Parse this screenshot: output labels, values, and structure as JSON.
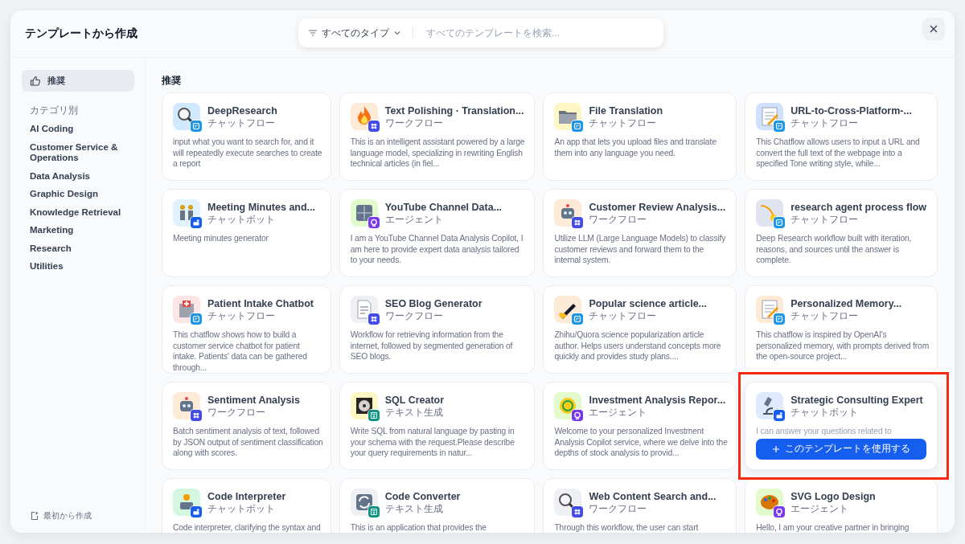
{
  "window": {
    "title": "テンプレートから作成"
  },
  "search": {
    "type_filter": "すべてのタイプ",
    "placeholder": "すべてのテンプレートを検索..."
  },
  "sidebar": {
    "recommended": {
      "label": "推奨",
      "selected": true
    },
    "category_heading": "カテゴリ別",
    "items": [
      {
        "label": "AI Coding",
        "selected": false
      },
      {
        "label": "Customer Service & Operations",
        "selected": false
      },
      {
        "label": "Data Analysis",
        "selected": false
      },
      {
        "label": "Graphic Design",
        "selected": false
      },
      {
        "label": "Knowledge Retrieval",
        "selected": false
      },
      {
        "label": "Marketing",
        "selected": false
      },
      {
        "label": "Research",
        "selected": false
      },
      {
        "label": "Utilities",
        "selected": false
      }
    ],
    "create_blank": "最初から作成"
  },
  "section_title": "推奨",
  "cards": [
    {
      "title": "DeepResearch",
      "type_label": "チャットフロー",
      "kind": "chatflow",
      "color": "#d1e9ff",
      "description": "input what you want to search for, and it will repeatedly execute searches to create a report",
      "hovered": false,
      "highlighted": false
    },
    {
      "title": "Text Polishing · Translation...",
      "type_label": "ワークフロー",
      "kind": "workflow",
      "color": "#fdead7",
      "description": "This is an intelligent assistant powered by a large language model, specializing in rewriting English technical articles (in fiel...",
      "hovered": false,
      "highlighted": false
    },
    {
      "title": "File Translation",
      "type_label": "チャットフロー",
      "kind": "chatflow",
      "color": "#fef7c3",
      "description": "An app that lets you upload files and translate them into any language you need.",
      "hovered": false,
      "highlighted": false
    },
    {
      "title": "URL-to-Cross-Platform-...",
      "type_label": "チャットフロー",
      "kind": "chatflow",
      "color": "#d1e0ff",
      "description": "This Chatflow allows users to input a URL and convert the full text of the webpage into a specified Tone writing style, while...",
      "hovered": false,
      "highlighted": false
    },
    {
      "title": "Meeting Minutes and...",
      "type_label": "チャットボット",
      "kind": "chatbot",
      "color": "#e0f2fe",
      "description": "Meeting minutes generator",
      "hovered": false,
      "highlighted": false
    },
    {
      "title": "YouTube Channel Data...",
      "type_label": "エージェント",
      "kind": "agent",
      "color": "#e3fbcc",
      "description": "I am a YouTube Channel Data Analysis Copilot, I am here to provide expert data analysis tailored to your needs.",
      "hovered": false,
      "highlighted": false
    },
    {
      "title": "Customer Review Analysis...",
      "type_label": "ワークフロー",
      "kind": "workflow",
      "color": "#fdead7",
      "description": "Utilize LLM (Large Language Models) to classify customer reviews and forward them to the internal system.",
      "hovered": false,
      "highlighted": false
    },
    {
      "title": "research agent process flow",
      "type_label": "チャットフロー",
      "kind": "chatflow",
      "color": "#e0e3f0",
      "description": "Deep Research workflow built with iteration, reasons, and sources until the answer is complete.",
      "hovered": false,
      "highlighted": false
    },
    {
      "title": "Patient Intake Chatbot",
      "type_label": "チャットフロー",
      "kind": "chatflow",
      "color": "#fde4e6",
      "description": "This chatflow shows how to build a customer service chatbot for patient intake. Patients' data can be gathered through...",
      "hovered": false,
      "highlighted": false
    },
    {
      "title": "SEO Blog Generator",
      "type_label": "ワークフロー",
      "kind": "workflow",
      "color": "#eef0f3",
      "description": "Workflow for retrieving information from the internet, followed by segmented generation of SEO blogs.",
      "hovered": false,
      "highlighted": false
    },
    {
      "title": "Popular science article...",
      "type_label": "チャットフロー",
      "kind": "chatflow",
      "color": "#fdead7",
      "description": "Zhihu/Quora science popularization article author. Helps users understand concepts more quickly and provides study plans....",
      "hovered": false,
      "highlighted": false
    },
    {
      "title": "Personalized Memory...",
      "type_label": "チャットフロー",
      "kind": "chatflow",
      "color": "#fdead7",
      "description": "This chatflow is inspired by OpenAI's personalized memory, with prompts derived from the open-source project...",
      "hovered": false,
      "highlighted": false
    },
    {
      "title": "Sentiment Analysis",
      "type_label": "ワークフロー",
      "kind": "workflow",
      "color": "#fdead7",
      "description": "Batch sentiment analysis of text, followed by JSON output of sentiment classification along with scores.",
      "hovered": false,
      "highlighted": false
    },
    {
      "title": "SQL Creator",
      "type_label": "テキスト生成",
      "kind": "completion",
      "color": "#fef7c3",
      "description": "Write SQL from natural language by pasting in your schema with the request.Please describe your query requirements in natur...",
      "hovered": false,
      "highlighted": false
    },
    {
      "title": "Investment Analysis Repor...",
      "type_label": "エージェント",
      "kind": "agent",
      "color": "#e3fbcc",
      "description": "Welcome to your personalized Investment Analysis Copilot service, where we delve into the depths of stock analysis to provid...",
      "hovered": false,
      "highlighted": false
    },
    {
      "title": "Strategic Consulting Expert",
      "type_label": "チャットボット",
      "kind": "chatbot",
      "color": "#e0eaff",
      "description": "I can answer your questions related to",
      "hovered": true,
      "highlighted": true,
      "use_button": "このテンプレートを使用する"
    },
    {
      "title": "Code Interpreter",
      "type_label": "チャットボット",
      "kind": "chatbot",
      "color": "#d3f8df",
      "description": "Code interpreter, clarifying the syntax and",
      "hovered": false,
      "highlighted": false
    },
    {
      "title": "Code Converter",
      "type_label": "テキスト生成",
      "kind": "completion",
      "color": "#eef0f3",
      "description": "This is an application that provides the",
      "hovered": false,
      "highlighted": false
    },
    {
      "title": "Web Content Search and...",
      "type_label": "ワークフロー",
      "kind": "workflow",
      "color": "#eef0f3",
      "description": "Through this workflow, the user can start",
      "hovered": false,
      "highlighted": false
    },
    {
      "title": "SVG Logo Design",
      "type_label": "エージェント",
      "kind": "agent",
      "color": "#e3fbcc",
      "description": "Hello, I am your creative partner in bringing",
      "hovered": false,
      "highlighted": false
    }
  ]
}
